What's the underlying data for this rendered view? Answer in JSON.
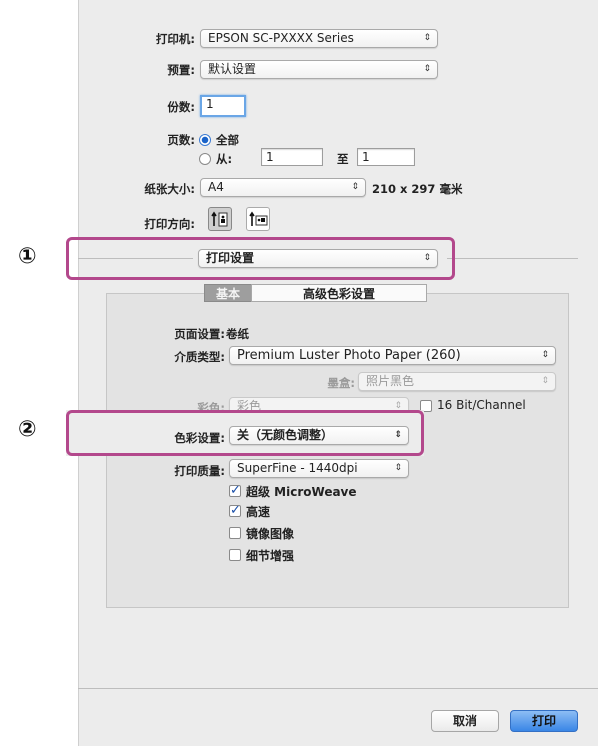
{
  "printer": {
    "label": "打印机:",
    "value": "EPSON SC-PXXXX Series"
  },
  "presets": {
    "label": "预置:",
    "value": "默认设置"
  },
  "copies": {
    "label": "份数:",
    "value": "1"
  },
  "pages": {
    "label": "页数:",
    "all_label": "全部",
    "from_label": "从:",
    "from_value": "1",
    "to_label": "至",
    "to_value": "1"
  },
  "paper_size": {
    "label": "纸张大小:",
    "value": "A4",
    "dimensions": "210 x 297 毫米"
  },
  "orientation": {
    "label": "打印方向:",
    "portrait_icon": "portrait-orientation-icon",
    "landscape_icon": "landscape-orientation-icon"
  },
  "section_popup": {
    "value": "打印设置"
  },
  "tabs": [
    {
      "label": "基本",
      "selected": true
    },
    {
      "label": "高级色彩设置",
      "selected": false
    }
  ],
  "settings": {
    "page_setup_label": "页面设置:",
    "page_setup_value": "卷纸",
    "media_label": "介质类型:",
    "media_value": "Premium Luster Photo Paper (260)",
    "ink_label": "墨盒:",
    "ink_value": "照片黑色",
    "color_label": "彩色:",
    "color_value": "彩色",
    "bit_label": "16 Bit/Channel",
    "color_settings_label": "色彩设置:",
    "color_settings_value": "关（无颜色调整）",
    "quality_label": "打印质量:",
    "quality_value": "SuperFine - 1440dpi"
  },
  "checkboxes": [
    {
      "label": "超级 MicroWeave",
      "checked": true
    },
    {
      "label": "高速",
      "checked": true
    },
    {
      "label": "镜像图像",
      "checked": false
    },
    {
      "label": "细节增强",
      "checked": false
    }
  ],
  "callouts": {
    "one": "①",
    "two": "②"
  },
  "buttons": {
    "cancel": "取消",
    "print": "打印"
  },
  "colors": {
    "highlight": "#b3488c",
    "accent": "#3a86e6"
  }
}
